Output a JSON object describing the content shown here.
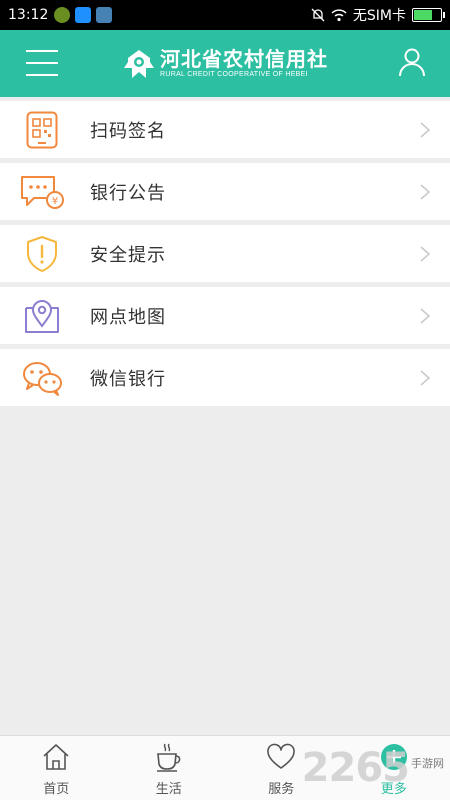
{
  "status_bar": {
    "time": "13:12",
    "carrier": "无SIM卡",
    "colors": {
      "icon1": "#6b8e23",
      "icon2": "#1e90ff",
      "icon3": "#4682b4",
      "battery": "#4cd964"
    }
  },
  "header": {
    "logo_title": "河北省农村信用社",
    "logo_subtitle": "RURAL CREDIT COOPERATIVE OF HEBEI",
    "background": "#2dbfa2",
    "menu_icon": "hamburger-menu-icon",
    "user_icon": "user-icon"
  },
  "menu_items": [
    {
      "label": "扫码签名",
      "icon": "qr-scan-icon",
      "color": "#f0883e"
    },
    {
      "label": "银行公告",
      "icon": "announcement-icon",
      "color": "#f0883e"
    },
    {
      "label": "安全提示",
      "icon": "security-shield-icon",
      "color": "#f5b83d"
    },
    {
      "label": "网点地图",
      "icon": "map-pin-icon",
      "color": "#8a7fd0"
    },
    {
      "label": "微信银行",
      "icon": "wechat-icon",
      "color": "#f0883e"
    }
  ],
  "tabs": [
    {
      "label": "首页",
      "icon": "home-icon"
    },
    {
      "label": "生活",
      "icon": "coffee-cup-icon"
    },
    {
      "label": "服务",
      "icon": "heart-icon"
    },
    {
      "label": "更多",
      "icon": "plus-icon",
      "active": true
    }
  ],
  "watermark": {
    "number": "2265",
    "text": "手游网"
  }
}
